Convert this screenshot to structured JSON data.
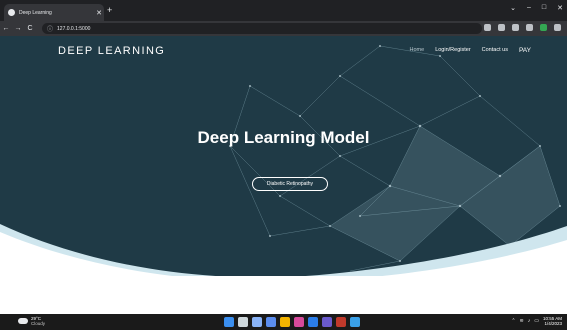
{
  "browser": {
    "tab_title": "Deep Learning",
    "tab_close": "✕",
    "new_tab": "+",
    "url": "127.0.0.1:5000",
    "back": "←",
    "forward": "→",
    "reload": "C",
    "window_controls": [
      "⌄",
      "–",
      "□",
      "✕"
    ]
  },
  "site": {
    "brand": "DEEP LEARNING",
    "nav": [
      "Home",
      "Login/Register",
      "Contact us",
      "PAY"
    ],
    "headline": "Deep Learning Model",
    "cta_label": "Diabetic Retinopathy"
  },
  "taskbar": {
    "weather_temp": "29°C",
    "weather_cond": "Cloudy",
    "time": "10:55 AM",
    "date": "1/4/2023",
    "app_colors": [
      "#3b8ff0",
      "#cfd8dc",
      "#8ab4f8",
      "#5b8def",
      "#f4b400",
      "#d84a9c",
      "#2b7de9",
      "#6a5acd",
      "#c0392b",
      "#3aa0e8"
    ]
  },
  "colors": {
    "hero_bg": "#1f3a46",
    "browser_dark": "#202124",
    "taskbar": "#1a1a1a"
  }
}
